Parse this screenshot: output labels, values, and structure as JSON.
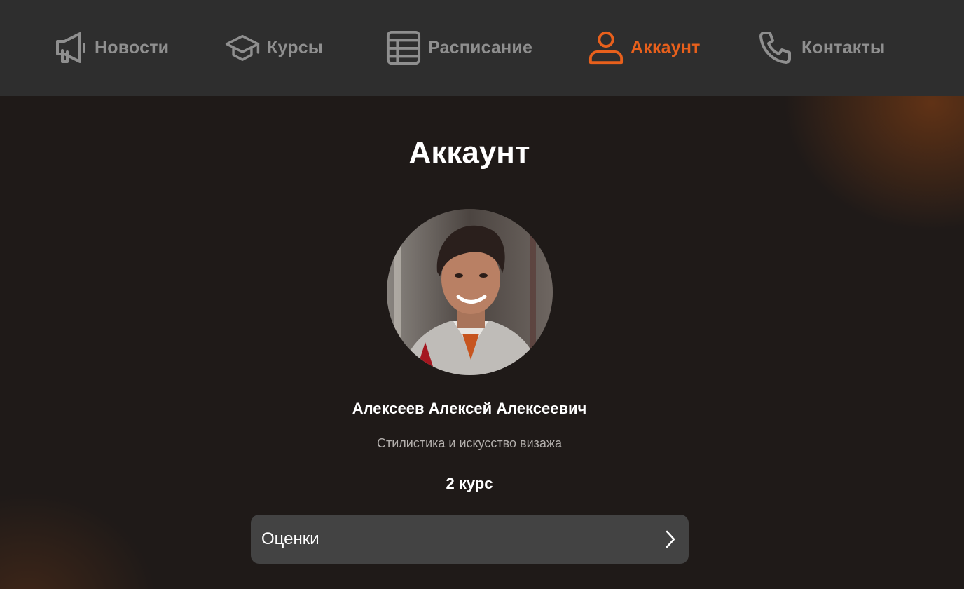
{
  "nav": {
    "items": [
      {
        "label": "Новости",
        "icon": "megaphone-icon",
        "active": false
      },
      {
        "label": "Курсы",
        "icon": "graduation-cap-icon",
        "active": false
      },
      {
        "label": "Расписание",
        "icon": "table-icon",
        "active": false
      },
      {
        "label": "Аккаунт",
        "icon": "user-icon",
        "active": true
      },
      {
        "label": "Контакты",
        "icon": "phone-icon",
        "active": false
      }
    ]
  },
  "account": {
    "title": "Аккаунт",
    "avatar_icon": "profile-photo",
    "full_name": "Алексеев Алексей Алексеевич",
    "program": "Стилистика и искусство визажа",
    "year": "2 курс",
    "grades_label": "Оценки",
    "grades_icon": "chevron-right-icon"
  },
  "colors": {
    "nav_background": "#2e2e2e",
    "nav_inactive": "#8f8f8f",
    "accent": "#e8601c",
    "page_background": "#1f1a18",
    "button_background": "#434343"
  }
}
